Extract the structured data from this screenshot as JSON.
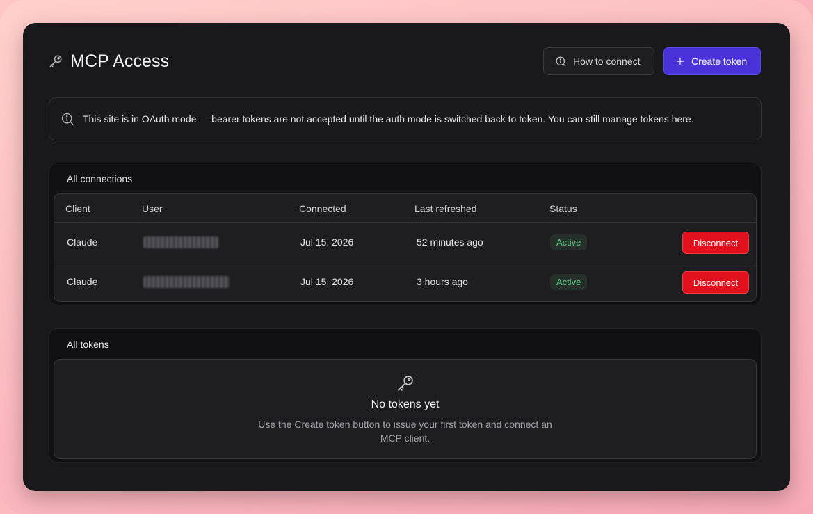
{
  "page": {
    "title": "MCP Access",
    "title_icon": "key-icon"
  },
  "actions": {
    "how_to_connect_label": "How to connect",
    "how_to_connect_icon": "info-search-icon",
    "create_token_label": "Create token",
    "create_token_icon": "plus-icon"
  },
  "banner": {
    "icon": "info-search-icon",
    "text": "This site is in OAuth mode — bearer tokens are not accepted until the auth mode is switched back to token. You can still manage tokens here."
  },
  "connections": {
    "title": "All connections",
    "columns": [
      "Client",
      "User",
      "Connected",
      "Last refreshed",
      "Status"
    ],
    "rows": [
      {
        "client": "Claude",
        "user": "[redacted]",
        "connected": "Jul 15, 2026",
        "last_refreshed": "52 minutes ago",
        "status": "Active",
        "action": "Disconnect"
      },
      {
        "client": "Claude",
        "user": "[redacted]",
        "connected": "Jul 15, 2026",
        "last_refreshed": "3 hours ago",
        "status": "Active",
        "action": "Disconnect"
      }
    ]
  },
  "tokens": {
    "title": "All tokens",
    "empty_icon": "key-icon",
    "empty_title": "No tokens yet",
    "empty_desc_line1": "Use the Create token button to issue your first token and connect an",
    "empty_desc_line2": "MCP client."
  },
  "colors": {
    "primary": "#4733d8",
    "danger": "#e0101c",
    "active_text": "#5fcf86",
    "background": "#19191b"
  }
}
